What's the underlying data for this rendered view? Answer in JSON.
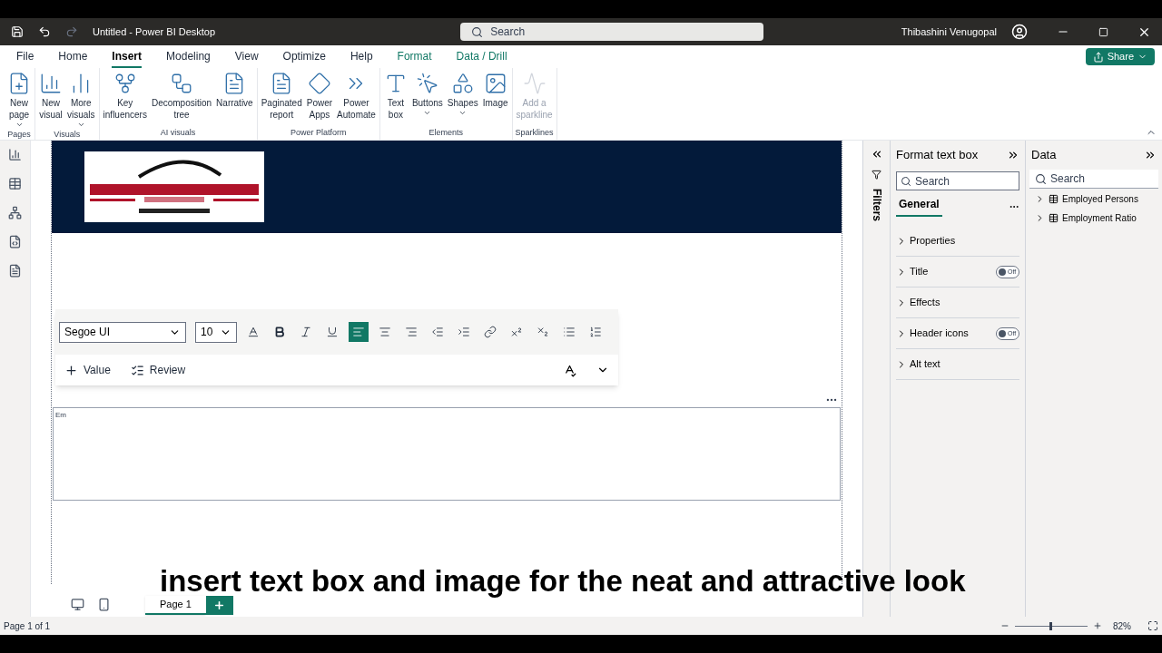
{
  "window": {
    "title": "Untitled - Power BI Desktop",
    "search_placeholder": "Search",
    "user": "Thibashini Venugopal"
  },
  "menu_tabs": [
    {
      "label": "File",
      "selected": false,
      "kind": "plain"
    },
    {
      "label": "Home",
      "selected": false,
      "kind": "plain"
    },
    {
      "label": "Insert",
      "selected": true,
      "kind": "plain"
    },
    {
      "label": "Modeling",
      "selected": false,
      "kind": "plain"
    },
    {
      "label": "View",
      "selected": false,
      "kind": "plain"
    },
    {
      "label": "Optimize",
      "selected": false,
      "kind": "plain"
    },
    {
      "label": "Help",
      "selected": false,
      "kind": "plain"
    },
    {
      "label": "Format",
      "selected": false,
      "kind": "context"
    },
    {
      "label": "Data / Drill",
      "selected": false,
      "kind": "context"
    }
  ],
  "share_button": "Share",
  "ribbon_groups": [
    {
      "label": "Pages",
      "items": [
        {
          "lines": [
            "New",
            "page"
          ],
          "dropdown": true,
          "disabled": false
        }
      ]
    },
    {
      "label": "Visuals",
      "items": [
        {
          "lines": [
            "New",
            "visual"
          ],
          "dropdown": false,
          "disabled": false
        },
        {
          "lines": [
            "More",
            "visuals"
          ],
          "dropdown": true,
          "disabled": false
        }
      ]
    },
    {
      "label": "AI visuals",
      "items": [
        {
          "lines": [
            "Key",
            "influencers"
          ],
          "dropdown": false,
          "disabled": false
        },
        {
          "lines": [
            "Decomposition",
            "tree"
          ],
          "dropdown": false,
          "disabled": false
        },
        {
          "lines": [
            "Narrative"
          ],
          "dropdown": false,
          "disabled": false
        }
      ]
    },
    {
      "label": "Power Platform",
      "items": [
        {
          "lines": [
            "Paginated",
            "report"
          ],
          "dropdown": false,
          "disabled": false
        },
        {
          "lines": [
            "Power",
            "Apps"
          ],
          "dropdown": false,
          "disabled": false
        },
        {
          "lines": [
            "Power",
            "Automate"
          ],
          "dropdown": false,
          "disabled": false
        }
      ]
    },
    {
      "label": "Elements",
      "items": [
        {
          "lines": [
            "Text",
            "box"
          ],
          "dropdown": false,
          "disabled": false
        },
        {
          "lines": [
            "Buttons"
          ],
          "dropdown": true,
          "disabled": false
        },
        {
          "lines": [
            "Shapes"
          ],
          "dropdown": true,
          "disabled": false
        },
        {
          "lines": [
            "Image"
          ],
          "dropdown": false,
          "disabled": false
        }
      ]
    },
    {
      "label": "Sparklines",
      "items": [
        {
          "lines": [
            "Add a",
            "sparkline"
          ],
          "dropdown": false,
          "disabled": true
        }
      ]
    }
  ],
  "text_toolbar": {
    "font": "Segoe UI",
    "size": "10",
    "tools": [
      {
        "kind": "color"
      },
      {
        "kind": "bold"
      },
      {
        "kind": "italic"
      },
      {
        "kind": "underline"
      },
      {
        "kind": "align-left",
        "selected": true
      },
      {
        "kind": "align-center",
        "selected": false
      },
      {
        "kind": "align-right",
        "selected": false
      },
      {
        "kind": "outdent"
      },
      {
        "kind": "indent"
      },
      {
        "kind": "link"
      },
      {
        "kind": "superscript"
      },
      {
        "kind": "subscript"
      },
      {
        "kind": "bullets"
      },
      {
        "kind": "numbers"
      }
    ],
    "actions": [
      "Value",
      "Review"
    ]
  },
  "text_box": {
    "value": "Em"
  },
  "filters_label": "Filters",
  "format_pane": {
    "title": "Format text box",
    "search_placeholder": "Search",
    "tab": "General",
    "sections": [
      {
        "label": "Properties",
        "toggle": false
      },
      {
        "label": "Title",
        "toggle": true,
        "on": false,
        "state_label": "Off"
      },
      {
        "label": "Effects",
        "toggle": false
      },
      {
        "label": "Header icons",
        "toggle": true,
        "on": false,
        "state_label": "Off"
      },
      {
        "label": "Alt text",
        "toggle": false
      }
    ]
  },
  "data_pane": {
    "title": "Data",
    "search_placeholder": "Search",
    "tables": [
      {
        "name": "Employed Persons",
        "expanded": false
      },
      {
        "name": "Employment Ratio",
        "expanded": false
      }
    ]
  },
  "page_tabs": [
    {
      "label": "Page 1",
      "selected": true
    }
  ],
  "status_bar": {
    "page_info": "Page 1 of 1",
    "zoom": "82%",
    "zoom_slider": {
      "level": 0.5
    }
  },
  "caption": "insert text box and image for the neat and attractive look"
}
